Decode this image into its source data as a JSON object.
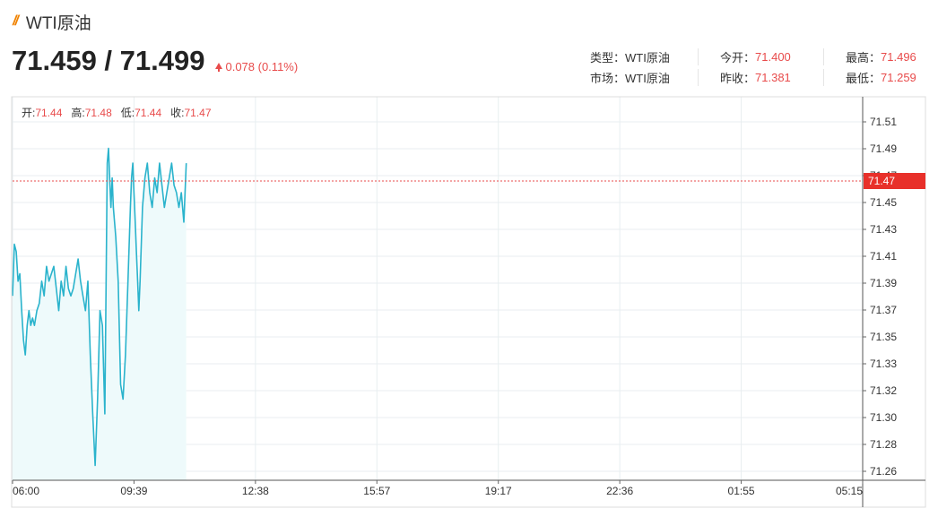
{
  "header": {
    "title": "WTI原油",
    "price": "71.459 / 71.499",
    "change": "0.078 (0.11%)"
  },
  "info": {
    "type_label": "类型：",
    "type_value": "WTI原油",
    "market_label": "市场：",
    "market_value": "WTI原油",
    "open_today_label": "今开：",
    "open_today_value": "71.400",
    "prev_close_label": "昨收：",
    "prev_close_value": "71.381",
    "high_label": "最高：",
    "high_value": "71.496",
    "low_label": "最低：",
    "low_value": "71.259"
  },
  "ohlc": {
    "open_label": "开:",
    "open_value": "71.44",
    "high_label": "高:",
    "high_value": "71.48",
    "low_label": "低:",
    "low_value": "71.44",
    "close_label": "收:",
    "close_value": "71.47"
  },
  "colors": {
    "line": "#2ab3cc",
    "area": "#eefafb",
    "grid": "#e8eef0",
    "red": "#e84b4b",
    "current_price_bg": "#e8302a"
  },
  "chart_data": {
    "type": "area",
    "x_tick_labels": [
      "06:00",
      "09:39",
      "12:38",
      "15:57",
      "19:17",
      "22:36",
      "01:55",
      "05:15"
    ],
    "y_tick_labels": [
      "71.51",
      "71.49",
      "71.47",
      "71.45",
      "71.43",
      "71.41",
      "71.39",
      "71.37",
      "71.35",
      "71.33",
      "71.32",
      "71.30",
      "71.28",
      "71.26"
    ],
    "ylim": [
      71.255,
      71.515
    ],
    "current_price_label": "71.47",
    "current_price": 71.47,
    "x_index_range": [
      0,
      1400
    ],
    "series": [
      {
        "x": [
          0,
          3,
          6,
          9,
          12,
          15,
          18,
          21,
          24,
          27,
          30,
          33,
          36,
          40,
          44,
          48,
          52,
          56,
          60,
          64,
          68,
          72,
          76,
          80,
          84,
          88,
          92,
          96,
          100,
          104,
          108,
          112,
          116,
          120,
          124,
          128,
          132,
          136,
          140,
          144,
          148,
          152,
          156,
          158,
          160,
          162,
          164,
          166,
          170,
          174,
          178,
          182,
          186,
          190,
          194,
          196,
          198,
          200,
          202,
          204,
          206,
          208,
          210,
          214,
          218,
          222,
          226,
          230,
          234,
          238,
          242,
          246,
          250,
          254,
          258,
          262,
          266,
          270,
          274,
          278,
          282,
          286
        ],
        "values": [
          71.38,
          71.415,
          71.41,
          71.39,
          71.395,
          71.37,
          71.35,
          71.34,
          71.36,
          71.37,
          71.36,
          71.365,
          71.36,
          71.37,
          71.375,
          71.39,
          71.38,
          71.4,
          71.39,
          71.395,
          71.4,
          71.385,
          71.37,
          71.39,
          71.38,
          71.4,
          71.385,
          71.38,
          71.385,
          71.395,
          71.405,
          71.39,
          71.38,
          71.37,
          71.39,
          71.34,
          71.3,
          71.265,
          71.31,
          71.37,
          71.36,
          71.3,
          71.47,
          71.48,
          71.46,
          71.44,
          71.46,
          71.44,
          71.42,
          71.39,
          71.32,
          71.31,
          71.34,
          71.39,
          71.44,
          71.46,
          71.47,
          71.45,
          71.43,
          71.41,
          71.39,
          71.37,
          71.39,
          71.44,
          71.46,
          71.47,
          71.45,
          71.44,
          71.46,
          71.45,
          71.47,
          71.455,
          71.44,
          71.45,
          71.46,
          71.47,
          71.455,
          71.45,
          71.44,
          71.45,
          71.43,
          71.47
        ]
      }
    ]
  }
}
